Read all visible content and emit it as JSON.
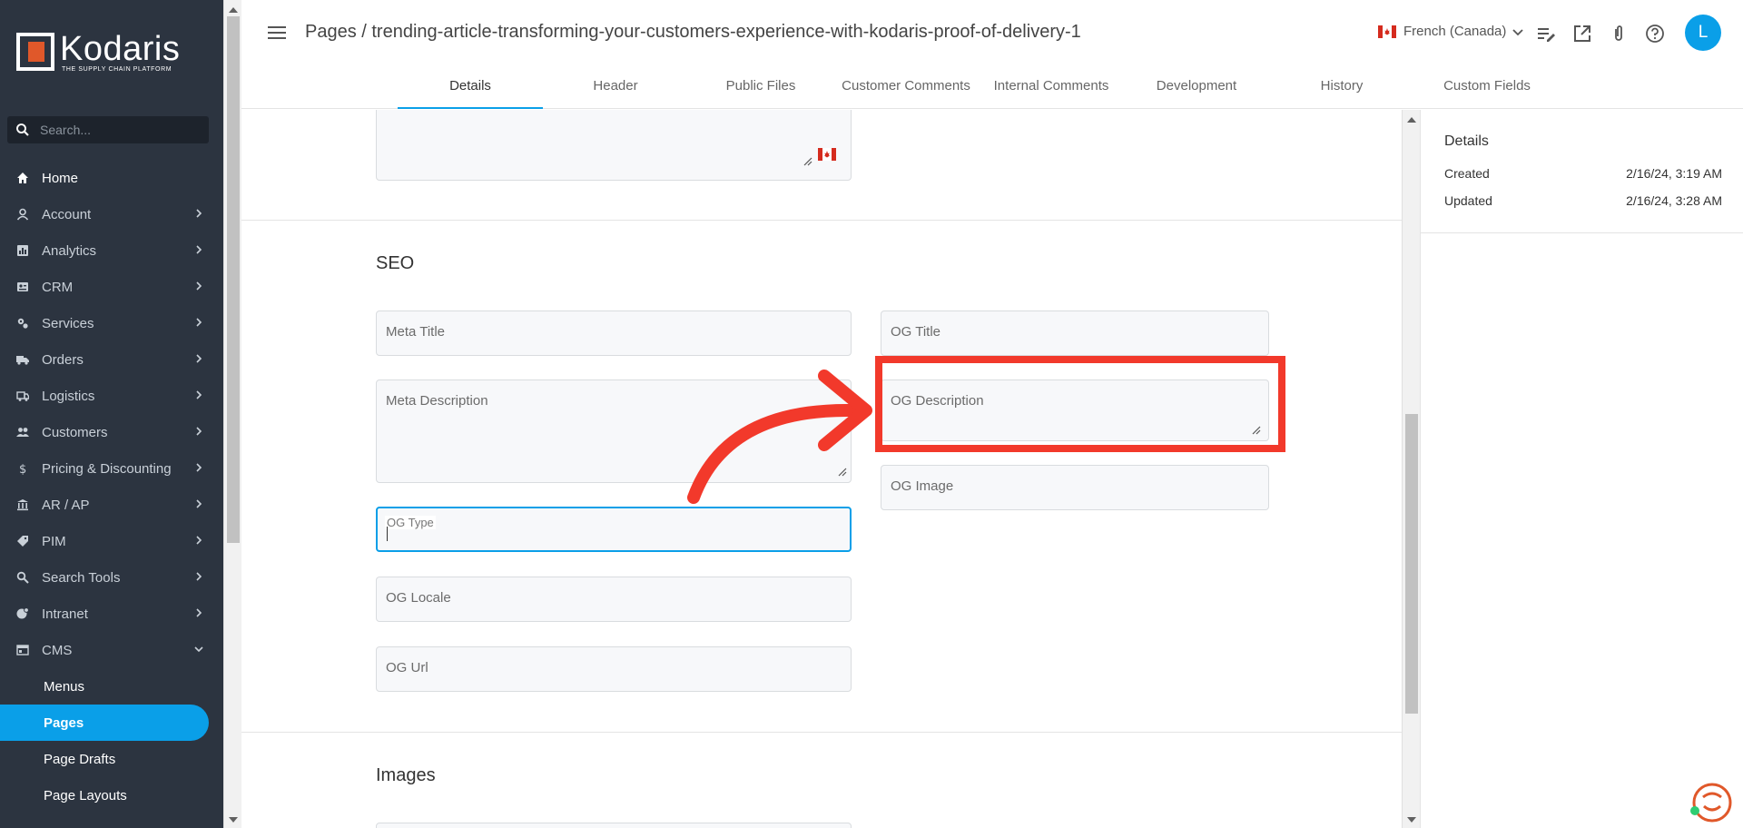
{
  "sidebar": {
    "logo_name": "Kodaris",
    "logo_tagline": "THE SUPPLY CHAIN PLATFORM",
    "search_placeholder": "Search...",
    "items": [
      {
        "label": "Home",
        "icon": "home-icon"
      },
      {
        "label": "Account",
        "icon": "account-icon"
      },
      {
        "label": "Analytics",
        "icon": "analytics-icon"
      },
      {
        "label": "CRM",
        "icon": "crm-icon"
      },
      {
        "label": "Services",
        "icon": "services-icon"
      },
      {
        "label": "Orders",
        "icon": "orders-icon"
      },
      {
        "label": "Logistics",
        "icon": "logistics-icon"
      },
      {
        "label": "Customers",
        "icon": "customers-icon"
      },
      {
        "label": "Pricing & Discounting",
        "icon": "dollar-icon"
      },
      {
        "label": "AR / AP",
        "icon": "bank-icon"
      },
      {
        "label": "PIM",
        "icon": "tag-icon"
      },
      {
        "label": "Search Tools",
        "icon": "search-icon"
      },
      {
        "label": "Intranet",
        "icon": "intranet-icon"
      },
      {
        "label": "CMS",
        "icon": "cms-icon"
      }
    ],
    "cms_sub_items": [
      "Menus",
      "Pages",
      "Page Drafts",
      "Page Layouts"
    ]
  },
  "header": {
    "breadcrumb": "Pages / trending-article-transforming-your-customers-experience-with-kodaris-proof-of-delivery-1",
    "language": "French (Canada)",
    "avatar_letter": "L",
    "tabs": [
      "Details",
      "Header",
      "Public Files",
      "Customer Comments",
      "Internal Comments",
      "Development",
      "History",
      "Custom Fields"
    ]
  },
  "seo": {
    "title": "SEO",
    "meta_title": "Meta Title",
    "og_title": "OG Title",
    "meta_description": "Meta Description",
    "og_description": "OG Description",
    "og_image": "OG Image",
    "og_type": "OG Type",
    "og_locale": "OG Locale",
    "og_url": "OG Url"
  },
  "images": {
    "title": "Images"
  },
  "details": {
    "title": "Details",
    "created_label": "Created",
    "created_value": "2/16/24, 3:19 AM",
    "updated_label": "Updated",
    "updated_value": "2/16/24, 3:28 AM"
  },
  "colors": {
    "accent": "#0a9fe8",
    "sidebar_bg": "#2c3440",
    "annotation": "#f2392b",
    "brand_orange": "#e0582a"
  }
}
